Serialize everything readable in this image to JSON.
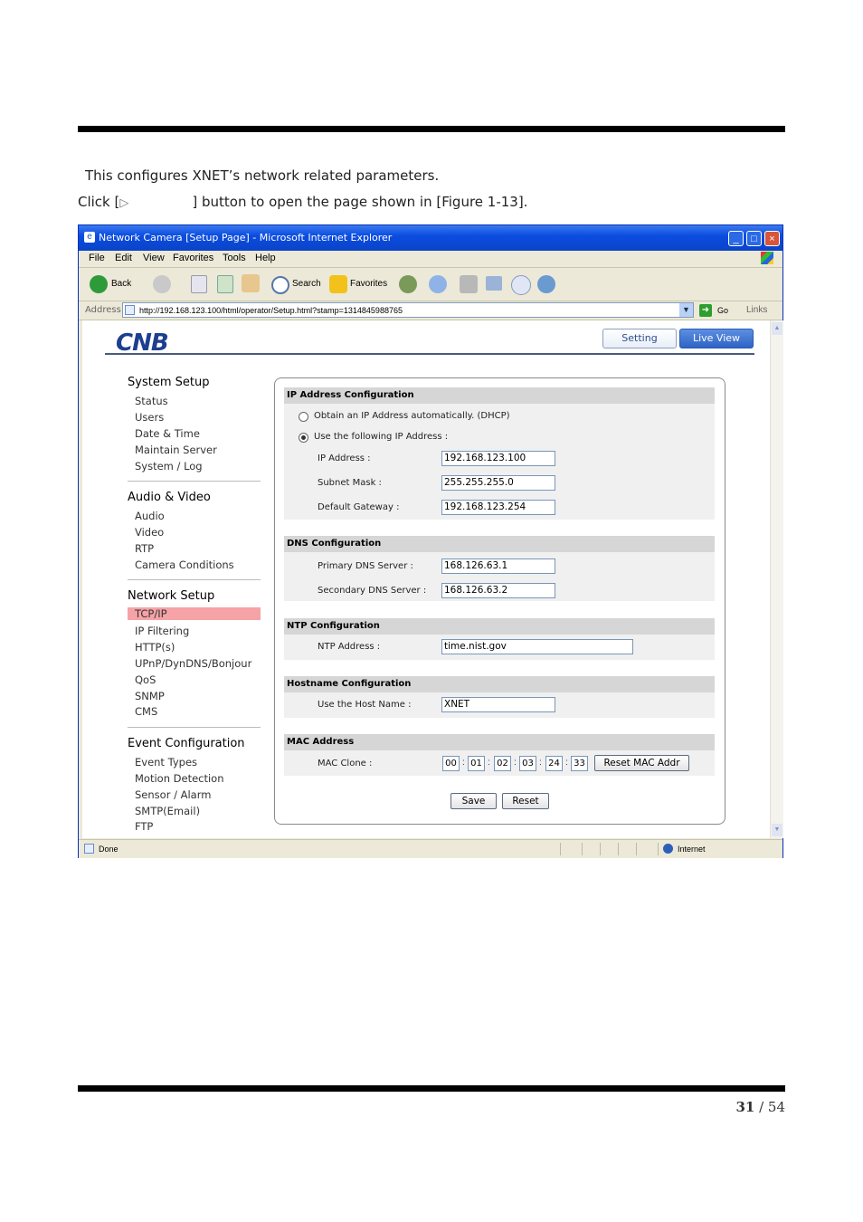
{
  "doc": {
    "line1": "This configures XNET’s network related parameters.",
    "line2_pre": "Click [",
    "line2_arrow": "▷",
    "line2_post": "] button to open the page shown in [Figure 1-13].",
    "page_current": "31",
    "page_sep": " / ",
    "page_total": "54"
  },
  "browser": {
    "title": "Network Camera [Setup Page] - Microsoft Internet Explorer",
    "menu": [
      "File",
      "Edit",
      "View",
      "Favorites",
      "Tools",
      "Help"
    ],
    "toolbar": {
      "back": "Back",
      "search": "Search",
      "favorites": "Favorites"
    },
    "address_label": "Address",
    "url": "http://192.168.123.100/html/operator/Setup.html?stamp=1314845988765",
    "go": "Go",
    "links": "Links",
    "status": "Done",
    "zone": "Internet"
  },
  "app": {
    "logo": "CNB",
    "setting_button": "Setting",
    "liveview_button": "Live View",
    "sidebar": [
      {
        "heading": "System Setup",
        "items": [
          "Status",
          "Users",
          "Date & Time",
          "Maintain Server",
          "System / Log"
        ]
      },
      {
        "heading": "Audio & Video",
        "items": [
          "Audio",
          "Video",
          "RTP",
          "Camera Conditions"
        ]
      },
      {
        "heading": "Network Setup",
        "items": [
          "TCP/IP",
          "IP Filtering",
          "HTTP(s)",
          "UPnP/DynDNS/Bonjour",
          "QoS",
          "SNMP",
          "CMS"
        ]
      },
      {
        "heading": "Event Configuration",
        "items": [
          "Event Types",
          "Motion Detection",
          "Sensor / Alarm",
          "SMTP(Email)",
          "FTP"
        ]
      }
    ],
    "active_item": "TCP/IP",
    "ip_section": {
      "title": "IP Address Configuration",
      "dhcp_label": "Obtain an IP Address automatically. (DHCP)",
      "static_label": "Use the following IP Address :",
      "ip_label": "IP Address :",
      "ip_value": "192.168.123.100",
      "mask_label": "Subnet Mask :",
      "mask_value": "255.255.255.0",
      "gw_label": "Default Gateway :",
      "gw_value": "192.168.123.254"
    },
    "dns_section": {
      "title": "DNS Configuration",
      "primary_label": "Primary DNS Server :",
      "primary_value": "168.126.63.1",
      "secondary_label": "Secondary DNS Server :",
      "secondary_value": "168.126.63.2"
    },
    "ntp_section": {
      "title": "NTP Configuration",
      "label": "NTP Address :",
      "value": "time.nist.gov"
    },
    "host_section": {
      "title": "Hostname Configuration",
      "label": "Use the Host Name :",
      "value": "XNET"
    },
    "mac_section": {
      "title": "MAC Address",
      "label": "MAC Clone :",
      "octets": [
        "00",
        "01",
        "02",
        "03",
        "24",
        "33"
      ],
      "reset_button": "Reset MAC Addr"
    },
    "save_button": "Save",
    "reset_button": "Reset"
  }
}
